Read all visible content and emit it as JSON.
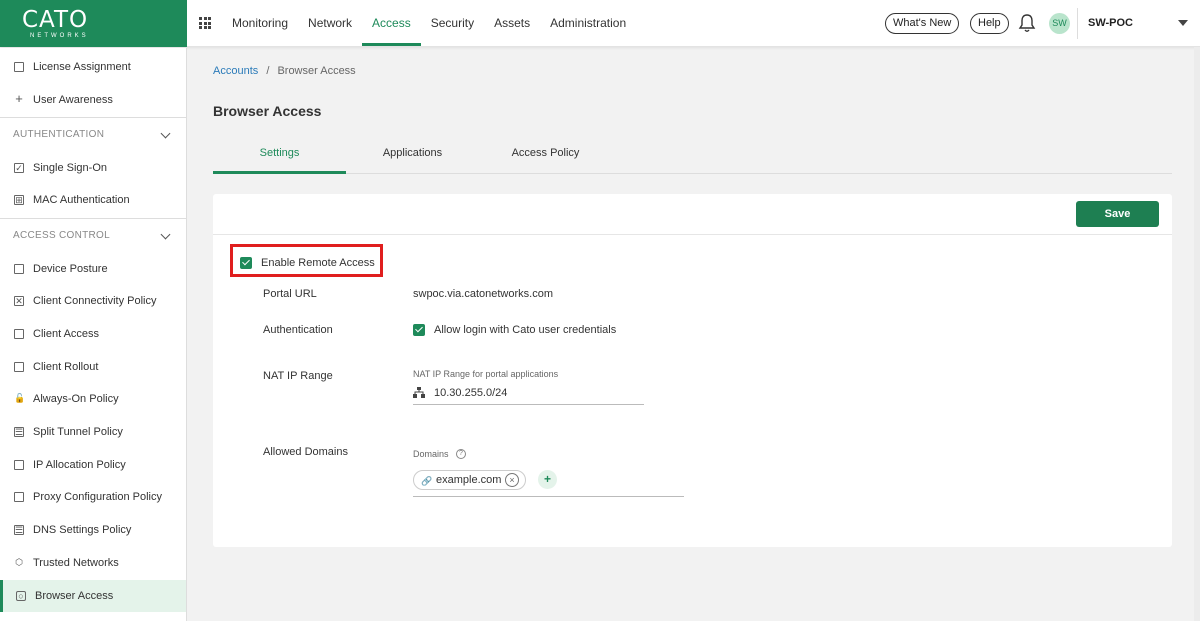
{
  "brand": {
    "name": "CATO",
    "sub": "NETWORKS",
    "color": "#1e8a5a"
  },
  "nav": {
    "items": [
      {
        "label": "Monitoring",
        "active": false
      },
      {
        "label": "Network",
        "active": false
      },
      {
        "label": "Access",
        "active": true
      },
      {
        "label": "Security",
        "active": false
      },
      {
        "label": "Assets",
        "active": false
      },
      {
        "label": "Administration",
        "active": false
      }
    ],
    "whats_new": "What's New",
    "help": "Help",
    "avatar": "SW",
    "account": "SW-POC"
  },
  "sidebar": {
    "items_top": [
      {
        "label": "License Assignment",
        "icon": "license-icon"
      },
      {
        "label": "User Awareness",
        "icon": "plus-icon"
      }
    ],
    "section_auth": "AUTHENTICATION",
    "items_auth": [
      {
        "label": "Single Sign-On",
        "icon": "check-square-icon"
      },
      {
        "label": "MAC Authentication",
        "icon": "grid-icon"
      }
    ],
    "section_access": "ACCESS CONTROL",
    "items_access": [
      {
        "label": "Device Posture",
        "icon": "monitor-icon"
      },
      {
        "label": "Client Connectivity Policy",
        "icon": "connectivity-icon"
      },
      {
        "label": "Client Access",
        "icon": "window-icon"
      },
      {
        "label": "Client Rollout",
        "icon": "window-icon"
      },
      {
        "label": "Always-On Policy",
        "icon": "lock-icon"
      },
      {
        "label": "Split Tunnel Policy",
        "icon": "split-icon"
      },
      {
        "label": "IP Allocation Policy",
        "icon": "ip-icon"
      },
      {
        "label": "Proxy Configuration Policy",
        "icon": "proxy-icon"
      },
      {
        "label": "DNS Settings Policy",
        "icon": "dns-icon"
      },
      {
        "label": "Trusted Networks",
        "icon": "cube-icon"
      },
      {
        "label": "Browser Access",
        "icon": "browser-icon",
        "active": true
      }
    ]
  },
  "breadcrumb": {
    "root": "Accounts",
    "separator": "/",
    "current": "Browser Access"
  },
  "page": {
    "title": "Browser Access",
    "tabs": [
      {
        "label": "Settings",
        "active": true
      },
      {
        "label": "Applications",
        "active": false
      },
      {
        "label": "Access Policy",
        "active": false
      }
    ],
    "save_label": "Save"
  },
  "form": {
    "enable_remote_access": {
      "label": "Enable Remote Access",
      "checked": true
    },
    "portal_url": {
      "label": "Portal URL",
      "value": "swpoc.via.catonetworks.com"
    },
    "authentication": {
      "label": "Authentication",
      "option": "Allow login with Cato user credentials",
      "checked": true
    },
    "nat_ip_range": {
      "label": "NAT IP Range",
      "field_label": "NAT IP Range for portal applications",
      "value": "10.30.255.0/24"
    },
    "allowed_domains": {
      "label": "Allowed Domains",
      "field_label": "Domains",
      "help": "?",
      "chips": [
        "example.com"
      ],
      "add": "+"
    }
  }
}
